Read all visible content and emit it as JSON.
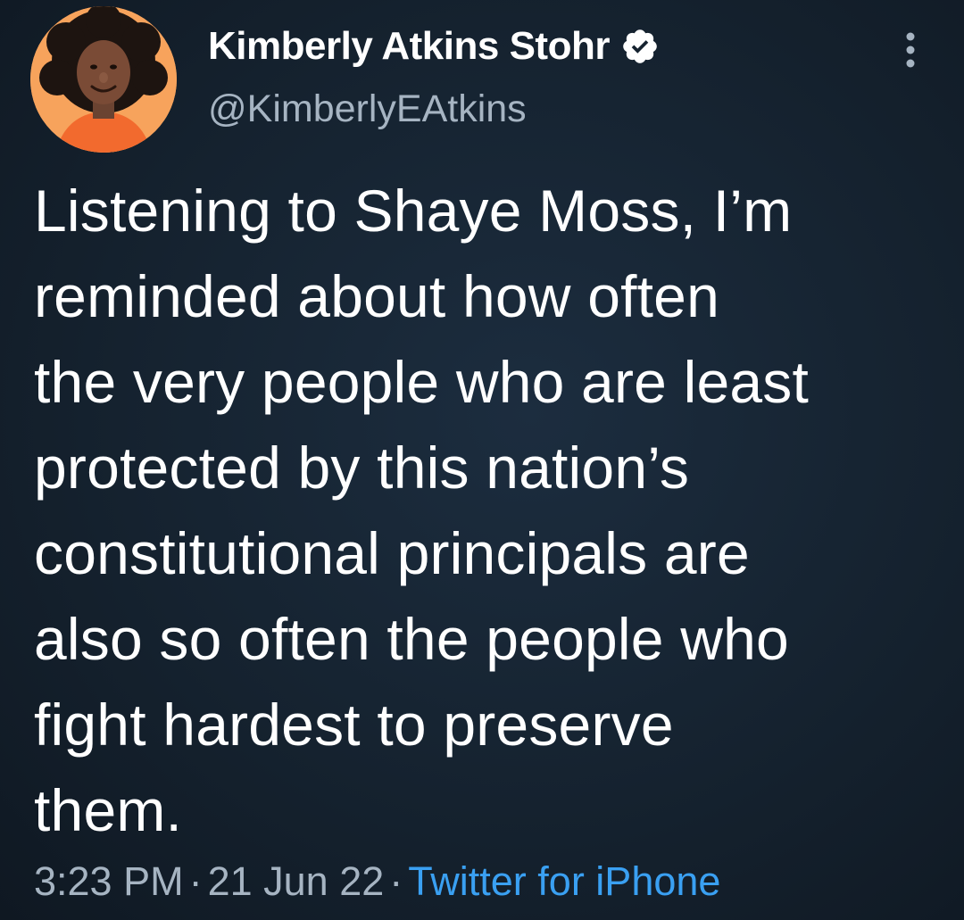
{
  "author": {
    "display_name": "Kimberly Atkins Stohr",
    "handle": "@KimberlyEAtkins",
    "verified_icon": "verified-badge-icon",
    "avatar_icon": "avatar-illustration"
  },
  "tweet": {
    "lines": [
      "Listening to Shaye Moss, I’m",
      "reminded about how often",
      "the very people who are least",
      "protected by this nation’s",
      "constitutional principals are",
      "also so often the people who",
      "fight hardest to preserve",
      "them."
    ]
  },
  "meta": {
    "time": "3:23 PM",
    "separator": "·",
    "date": "21 Jun 22",
    "source": "Twitter for iPhone"
  },
  "colors": {
    "background": "#15222f",
    "secondary_text": "#a6b4c2",
    "link": "#3aa0f2",
    "avatar_bg": "#f4a261"
  }
}
